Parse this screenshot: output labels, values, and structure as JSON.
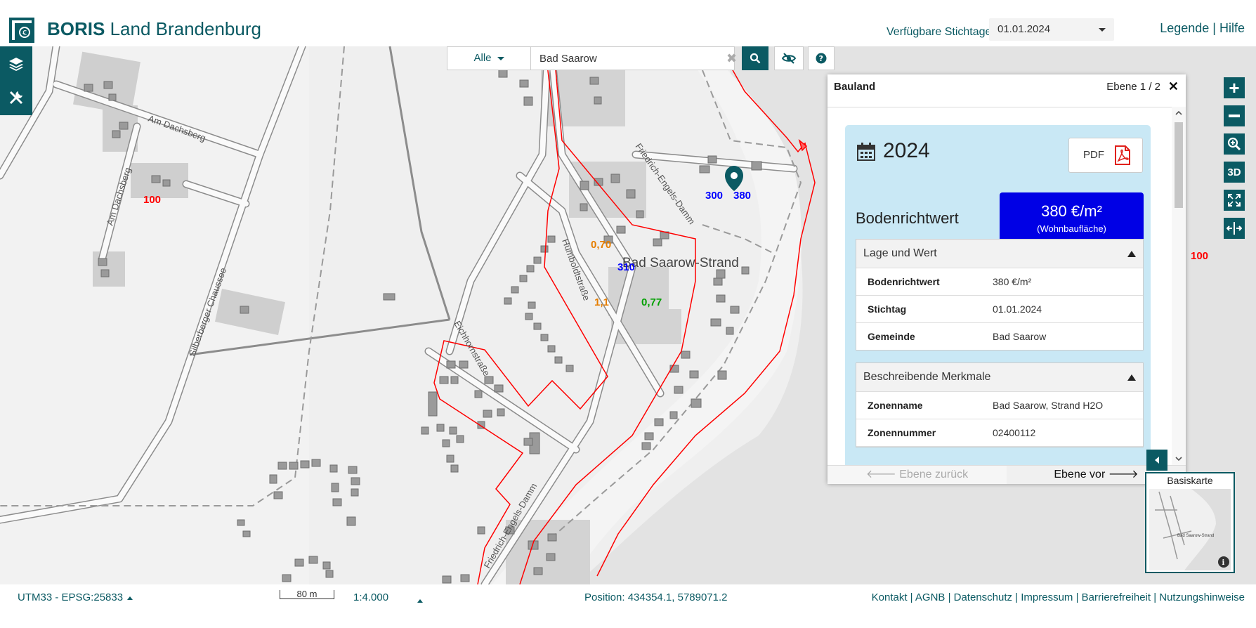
{
  "header": {
    "app_name_bold": "BORIS",
    "app_name_rest": " Land Brandenburg",
    "stichtag_label": "Verfügbare Stichtage:",
    "stichtag_value": "01.01.2024",
    "links": "Legende | Hilfe"
  },
  "search": {
    "category": "Alle",
    "value": "Bad Saarow"
  },
  "map": {
    "place_label": "Bad Saarow-Strand",
    "streets": [
      "Am Dachsberg",
      "Am Dachsberg",
      "Silberberger Chaussee",
      "Friedrich-Engels-Damm",
      "Humboldtstraße",
      "Eichhornstraße",
      "Friedrich-Engels-Damm"
    ],
    "value_labels": [
      {
        "text": "100",
        "color": "#ff0000"
      },
      {
        "text": "300",
        "color": "#0000ff"
      },
      {
        "text": "380",
        "color": "#0000ff"
      },
      {
        "text": "310",
        "color": "#0000ff"
      },
      {
        "text": "0,70",
        "color": "#e67e00"
      },
      {
        "text": "1,1",
        "color": "#e67e00"
      },
      {
        "text": "0,77",
        "color": "#00a000"
      },
      {
        "text": "100",
        "color": "#ff0000"
      }
    ],
    "accent_color": "#0b5a63"
  },
  "panel": {
    "title": "Bauland",
    "ebene": "Ebene 1 / 2",
    "year": "2024",
    "pdf_label": "PDF",
    "bodenrichtwert_label": "Bodenrichtwert",
    "value": "380 €/m²",
    "value_sub": "(Wohnbaufläche)",
    "section1": {
      "title": "Lage und Wert",
      "rows": [
        {
          "key": "Bodenrichtwert",
          "value": "380 €/m²"
        },
        {
          "key": "Stichtag",
          "value": "01.01.2024"
        },
        {
          "key": "Gemeinde",
          "value": "Bad Saarow"
        }
      ]
    },
    "section2": {
      "title": "Beschreibende Merkmale",
      "rows": [
        {
          "key": "Zonenname",
          "value": "Bad Saarow, Strand H2O"
        },
        {
          "key": "Zonennummer",
          "value": "02400112"
        }
      ]
    },
    "back_label": "🡐 Ebene zurück",
    "forward_label": "Ebene vor 🡒"
  },
  "minimap": {
    "title": "Basiskarte",
    "place_label": "Bad Saarow-Strand"
  },
  "footer": {
    "crs": "UTM33 - EPSG:25833",
    "scale_bar": "80 m",
    "scale": "1:4.000",
    "position": "Position: 434354.1, 5789071.2",
    "links": "Kontakt | AGNB | Datenschutz | Impressum | Barrierefreiheit | Nutzungshinweise"
  }
}
